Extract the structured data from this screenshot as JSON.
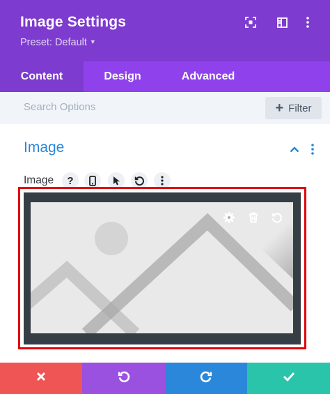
{
  "header": {
    "title": "Image Settings",
    "preset_label": "Preset: Default",
    "icons": [
      "focus-mode-icon",
      "sidebar-layout-icon",
      "more-vertical-icon"
    ]
  },
  "tabs": [
    {
      "label": "Content",
      "active": true
    },
    {
      "label": "Design",
      "active": false
    },
    {
      "label": "Advanced",
      "active": false
    }
  ],
  "search": {
    "placeholder": "Search Options",
    "filter_label": "Filter"
  },
  "section": {
    "title": "Image",
    "expanded": true
  },
  "field": {
    "label": "Image",
    "option_icons": [
      "help-icon",
      "responsive-phone-icon",
      "hover-cursor-icon",
      "reset-icon",
      "more-vertical-icon"
    ]
  },
  "image_upload": {
    "tool_icons": [
      "settings-gear-icon",
      "delete-trash-icon",
      "reset-icon"
    ]
  },
  "footer": {
    "buttons": [
      {
        "name": "discard",
        "icon": "close-icon",
        "color": "#ef5555"
      },
      {
        "name": "undo",
        "icon": "undo-icon",
        "color": "#9b51e0"
      },
      {
        "name": "redo",
        "icon": "redo-icon",
        "color": "#2b87da"
      },
      {
        "name": "save",
        "icon": "check-icon",
        "color": "#29c4a9"
      }
    ]
  },
  "colors": {
    "header": "#7e3bd0",
    "tabs": "#8f42ec",
    "accent": "#2b87da",
    "highlight": "#e3000b"
  }
}
